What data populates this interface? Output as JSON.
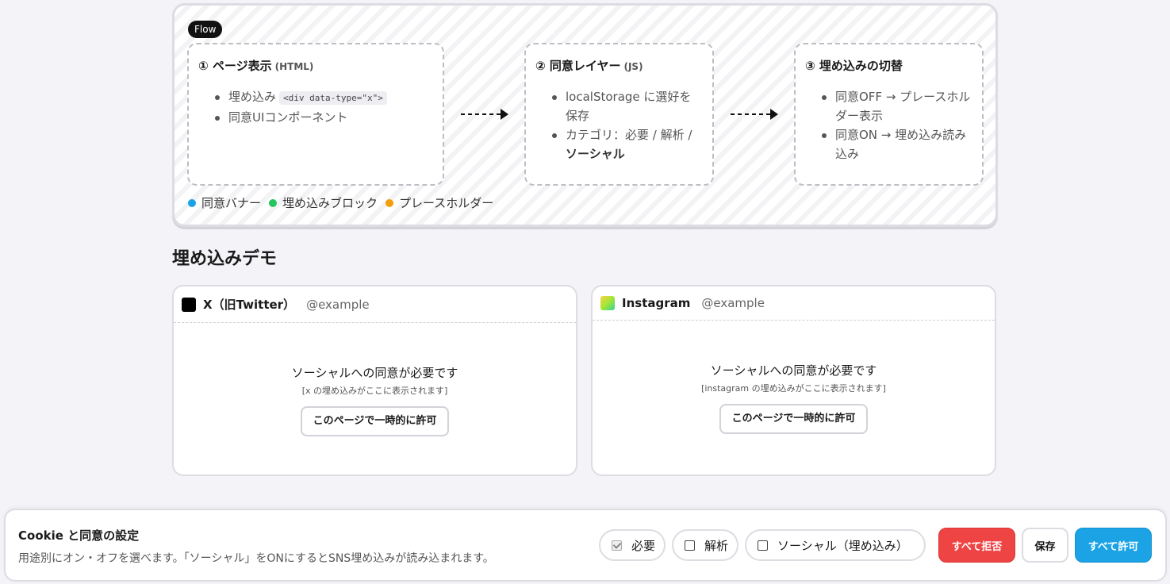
{
  "flow": {
    "tag": "Flow",
    "steps": [
      {
        "title": "① ページ表示",
        "sub": "(HTML)",
        "items": [
          {
            "text": "埋め込み",
            "code": "<div data-type=\"x\">"
          },
          {
            "text": "同意UIコンポーネント"
          }
        ]
      },
      {
        "title": "② 同意レイヤー",
        "sub": "(JS)",
        "items": [
          {
            "text": "localStorage に選好を保存"
          },
          {
            "text": "カテゴリ：必要 / 解析 / ",
            "bold": "ソーシャル"
          }
        ]
      },
      {
        "title": "③ 埋め込みの切替",
        "sub": "",
        "items": [
          {
            "text": "同意OFF → プレースホルダー表示"
          },
          {
            "text": "同意ON → 埋め込み読み込み"
          }
        ]
      }
    ],
    "legend": [
      {
        "label": "同意バナー",
        "color": "#1aa3e8"
      },
      {
        "label": "埋め込みブロック",
        "color": "#22c55e"
      },
      {
        "label": "プレースホルダー",
        "color": "#f59e0b"
      }
    ]
  },
  "demo": {
    "title": "埋め込みデモ",
    "cards": [
      {
        "name": "X（旧Twitter）",
        "handle": "@example",
        "icon": "x-logo-icon",
        "message": "ソーシャルへの同意が必要です",
        "hint": "[x の埋め込みがここに表示されます]",
        "button": "このページで一時的に許可"
      },
      {
        "name": "Instagram",
        "handle": "@example",
        "icon": "instagram-logo-icon",
        "message": "ソーシャルへの同意が必要です",
        "hint": "[instagram の埋め込みがここに表示されます]",
        "button": "このページで一時的に許可"
      }
    ]
  },
  "cookie": {
    "title": "Cookie と同意の設定",
    "description": "用途別にオン・オフを選べます。「ソーシャル」をONにするとSNS埋め込みが読み込まれます。",
    "options": [
      {
        "label": "必要",
        "checked": true,
        "disabled": true
      },
      {
        "label": "解析",
        "checked": false,
        "disabled": false
      },
      {
        "label": "ソーシャル（埋め込み）",
        "checked": false,
        "disabled": false
      }
    ],
    "reject_all": "すべて拒否",
    "save": "保存",
    "accept_all": "すべて許可",
    "colors": {
      "reject": "#ef4444",
      "accept": "#1ba3e6"
    }
  }
}
